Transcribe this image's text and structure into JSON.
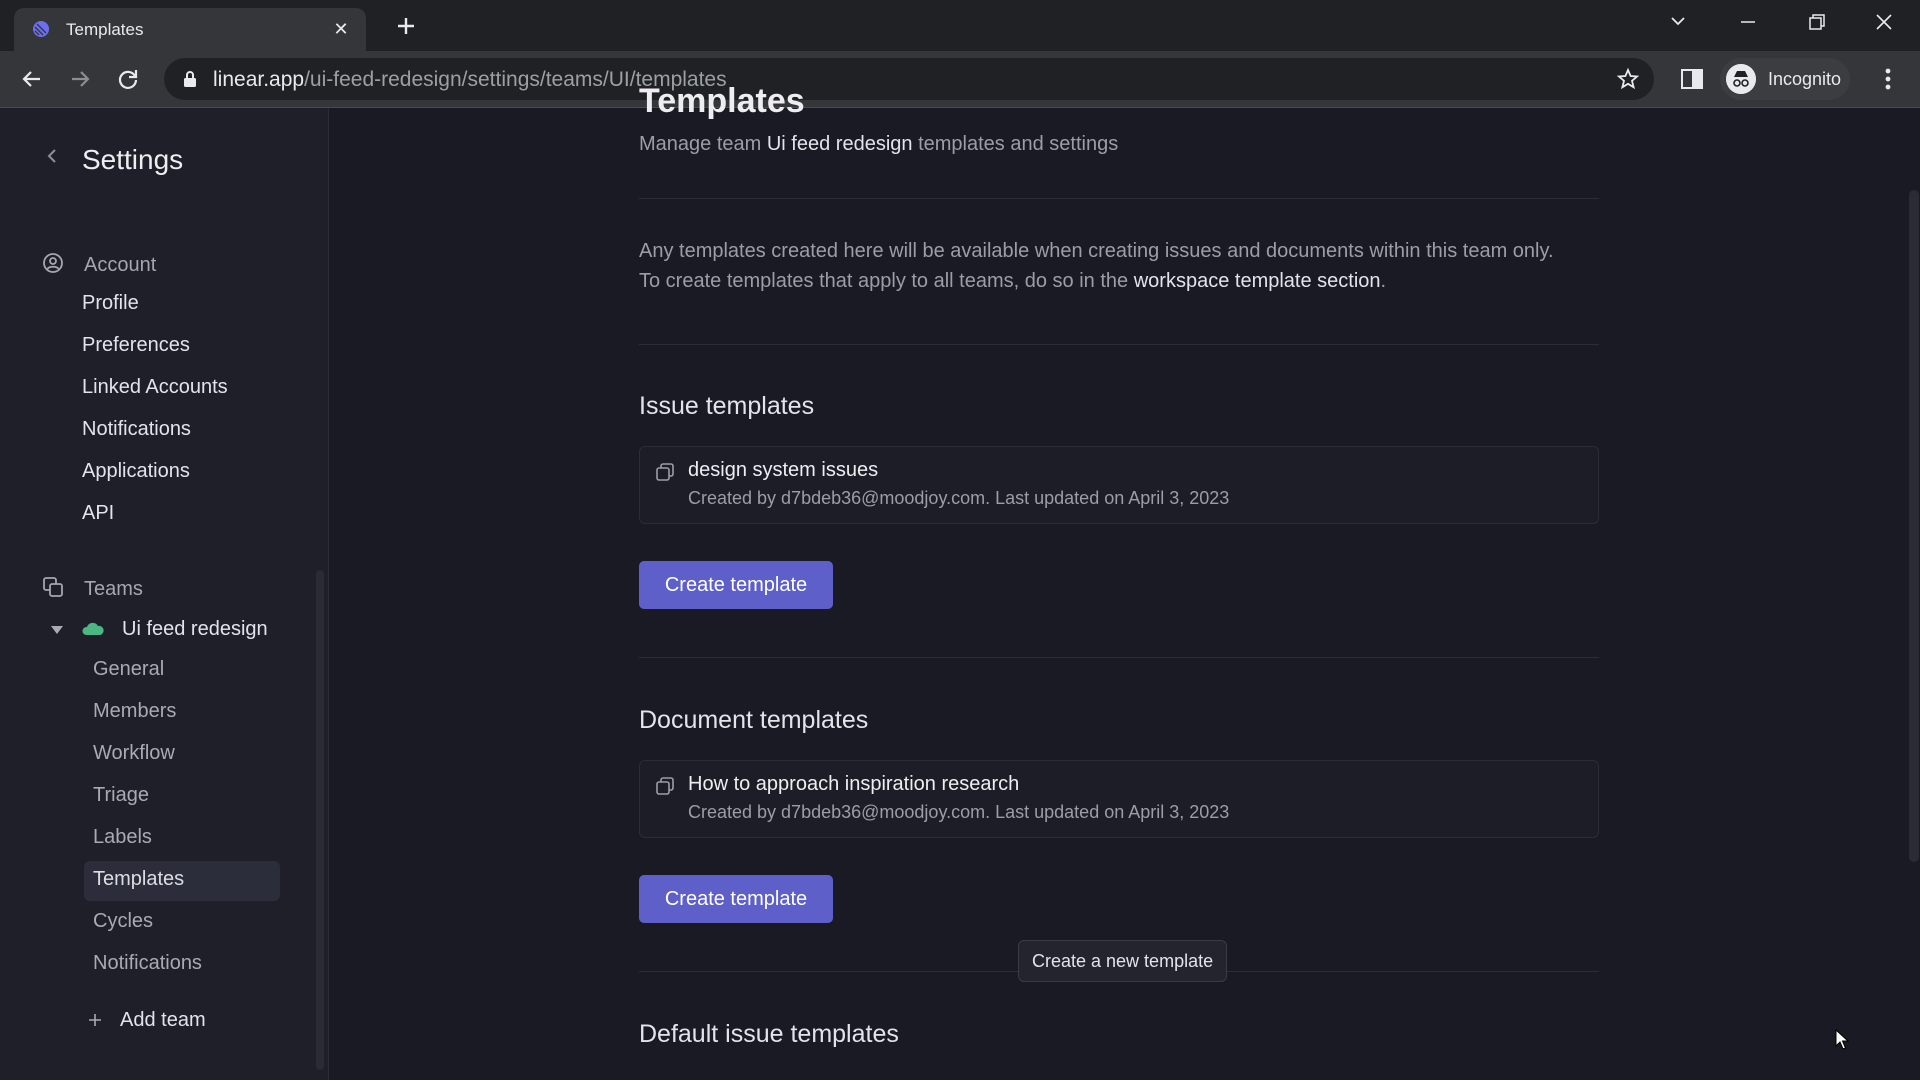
{
  "browser": {
    "tab_title": "Templates",
    "url_host": "linear.app",
    "url_path": "/ui-feed-redesign/settings/teams/UI/templates",
    "profile_label": "Incognito"
  },
  "sidebar": {
    "title": "Settings",
    "account_section": "Account",
    "account_items": [
      "Profile",
      "Preferences",
      "Linked Accounts",
      "Notifications",
      "Applications",
      "API"
    ],
    "teams_section": "Teams",
    "team_name": "Ui feed redesign",
    "team_color": "#4cb782",
    "team_items": [
      "General",
      "Members",
      "Workflow",
      "Triage",
      "Labels",
      "Templates",
      "Cycles",
      "Notifications"
    ],
    "active_item": "Templates",
    "add_team": "Add team"
  },
  "main": {
    "title": "Templates",
    "subtitle_prefix": "Manage team",
    "subtitle_team": "Ui feed redesign",
    "subtitle_suffix": "templates and settings",
    "info_line1": "Any templates created here will be available when creating issues and documents within this team only.",
    "info_line2_prefix": "To create templates that apply to all teams, do so in the",
    "info_link": "workspace template section",
    "info_line2_suffix": ".",
    "issue_section": {
      "heading": "Issue templates",
      "template_name": "design system issues",
      "template_meta": "Created by d7bdeb36@moodjoy.com. Last updated on April 3, 2023",
      "button": "Create template"
    },
    "document_section": {
      "heading": "Document templates",
      "template_name": "How to approach inspiration research",
      "template_meta": "Created by d7bdeb36@moodjoy.com. Last updated on April 3, 2023",
      "button": "Create template"
    },
    "tooltip": "Create a new template",
    "default_section_heading": "Default issue templates"
  },
  "colors": {
    "accent": "#5e5fc8",
    "background": "#191a23",
    "sidebar": "#1e1f28"
  }
}
